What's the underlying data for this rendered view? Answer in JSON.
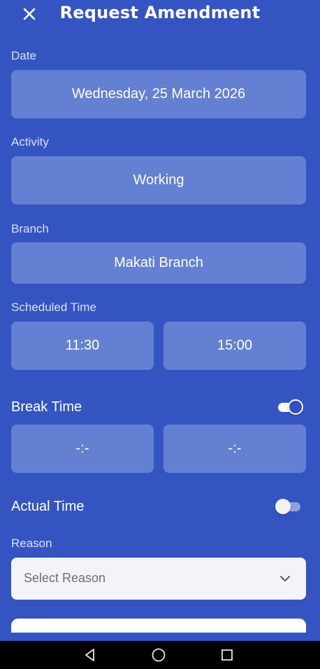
{
  "header": {
    "title": "Request Amendment",
    "close_icon": "close-icon"
  },
  "date": {
    "label": "Date",
    "value": "Wednesday, 25 March 2026"
  },
  "activity": {
    "label": "Activity",
    "value": "Working"
  },
  "branch": {
    "label": "Branch",
    "value": "Makati Branch"
  },
  "scheduled_time": {
    "label": "Scheduled Time",
    "start": "11:30",
    "end": "15:00"
  },
  "break_time": {
    "label": "Break Time",
    "enabled": true,
    "start": "-:-",
    "end": "-:-"
  },
  "actual_time": {
    "label": "Actual Time",
    "enabled": false
  },
  "reason": {
    "label": "Reason",
    "placeholder": "Select Reason"
  },
  "colors": {
    "background": "#3455c1",
    "field": "#6480d2",
    "select_bg": "#f4f3f8"
  }
}
